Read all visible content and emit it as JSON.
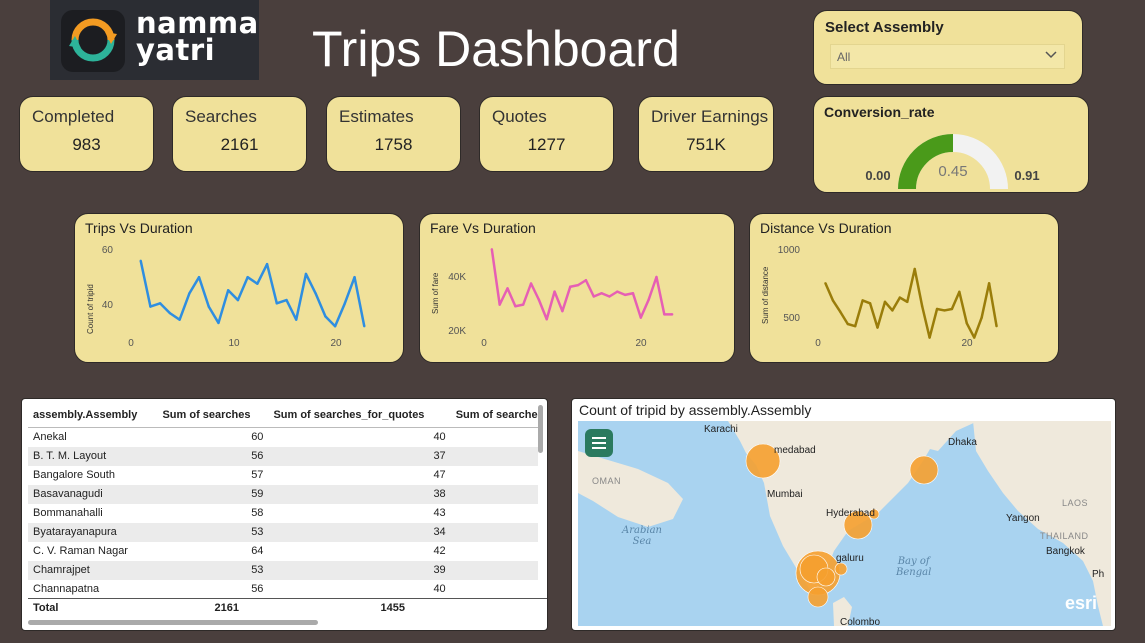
{
  "logo": {
    "line1": "namma",
    "line2": "yatri"
  },
  "page_title": "Trips Dashboard",
  "select_assembly": {
    "title": "Select Assembly",
    "value": "All"
  },
  "kpis": [
    {
      "label": "Completed",
      "value": "983"
    },
    {
      "label": "Searches",
      "value": "2161"
    },
    {
      "label": "Estimates",
      "value": "1758"
    },
    {
      "label": "Quotes",
      "value": "1277"
    },
    {
      "label": "Driver Earnings",
      "value": "751K"
    }
  ],
  "gauge": {
    "title": "Conversion_rate",
    "min": "0.00",
    "max": "0.91",
    "value": "0.45",
    "fraction": 0.5,
    "fill_color": "#4a9a1a",
    "track_color": "#f2f2f2"
  },
  "charts": {
    "trips": {
      "title": "Trips Vs Duration",
      "ylabel": "Count of tripid",
      "ytick_labels": [
        "60",
        "40"
      ],
      "xtick_labels": [
        "0",
        "10",
        "20"
      ],
      "color": "#2f8ee0"
    },
    "fare": {
      "title": "Fare Vs Duration",
      "ylabel": "Sum of fare",
      "ytick_labels": [
        "40K",
        "20K"
      ],
      "xtick_labels": [
        "0",
        "20"
      ],
      "color": "#e65fb4"
    },
    "distance": {
      "title": "Distance Vs Duration",
      "ylabel": "Sum of distance",
      "ytick_labels": [
        "1000",
        "500"
      ],
      "xtick_labels": [
        "0",
        "20"
      ],
      "color": "#9a7d0a"
    }
  },
  "chart_data": [
    {
      "type": "line",
      "title": "Trips Vs Duration",
      "xlabel": "",
      "ylabel": "Count of tripid",
      "x": [
        1,
        2,
        3,
        4,
        5,
        6,
        7,
        8,
        9,
        10,
        11,
        12,
        13,
        14,
        15,
        16,
        17,
        18,
        19,
        20,
        21,
        22,
        23,
        24
      ],
      "values": [
        53,
        39,
        40,
        37,
        35,
        43,
        48,
        39,
        34,
        44,
        41,
        48,
        46,
        52,
        40,
        41,
        35,
        49,
        43,
        36,
        33,
        40,
        48,
        33
      ],
      "ylim": [
        30,
        60
      ],
      "xlim": [
        0,
        25
      ]
    },
    {
      "type": "line",
      "title": "Fare Vs Duration",
      "xlabel": "",
      "ylabel": "Sum of fare",
      "x": [
        1,
        2,
        3,
        4,
        5,
        6,
        7,
        8,
        9,
        10,
        11,
        12,
        13,
        14,
        15,
        16,
        17,
        18,
        19,
        20,
        21,
        22,
        23,
        24
      ],
      "values": [
        46500,
        29500,
        34500,
        29000,
        29500,
        36000,
        31000,
        25000,
        33500,
        27500,
        35000,
        35500,
        37000,
        32000,
        33000,
        32000,
        33500,
        32500,
        33000,
        25500,
        31000,
        38000,
        26500,
        26500
      ],
      "ylim": [
        18000,
        50000
      ],
      "xlim": [
        0,
        25
      ]
    },
    {
      "type": "line",
      "title": "Distance Vs Duration",
      "xlabel": "",
      "ylabel": "Sum of distance",
      "x": [
        1,
        2,
        3,
        4,
        5,
        6,
        7,
        8,
        9,
        10,
        11,
        12,
        13,
        14,
        15,
        16,
        17,
        18,
        19,
        20,
        21,
        22,
        23,
        24
      ],
      "values": [
        760,
        640,
        560,
        475,
        460,
        640,
        620,
        450,
        630,
        570,
        660,
        630,
        860,
        600,
        380,
        580,
        570,
        580,
        700,
        480,
        380,
        520,
        760,
        460
      ],
      "ylim": [
        300,
        1000
      ],
      "xlim": [
        0,
        25
      ]
    }
  ],
  "table": {
    "columns": [
      "assembly.Assembly",
      "Sum of searches",
      "Sum of searches_for_quotes",
      "Sum of searches_got"
    ],
    "rows": [
      [
        "Anekal",
        "60",
        "40"
      ],
      [
        "B. T. M. Layout",
        "56",
        "37"
      ],
      [
        "Bangalore South",
        "57",
        "47"
      ],
      [
        "Basavanagudi",
        "59",
        "38"
      ],
      [
        "Bommanahalli",
        "58",
        "43"
      ],
      [
        "Byatarayanapura",
        "53",
        "34"
      ],
      [
        "C. V. Raman Nagar",
        "64",
        "42"
      ],
      [
        "Chamrajpet",
        "53",
        "39"
      ],
      [
        "Channapatna",
        "56",
        "40"
      ]
    ],
    "total": [
      "Total",
      "2161",
      "1455"
    ]
  },
  "map": {
    "title": "Count of tripid by assembly.Assembly",
    "labels": {
      "karachi": "Karachi",
      "ahmedabad": "medabad",
      "dhaka": "Dhaka",
      "mumbai": "Mumbai",
      "hyderabad": "Hyderabad",
      "bengaluru": "galuru",
      "yangon": "Yangon",
      "bangkok": "Bangkok",
      "colombo": "Colombo",
      "oman": "OMAN",
      "laos": "LAOS",
      "thailand": "THAILAND",
      "arabian_sea": "Arabian\nSea",
      "bay_of_bengal": "Bay of\nBengal",
      "esri": "esri",
      "ph": "Ph"
    },
    "bubble_color": "#f5a02f",
    "water_color": "#a9d3f0",
    "land_color": "#efe9dc"
  }
}
